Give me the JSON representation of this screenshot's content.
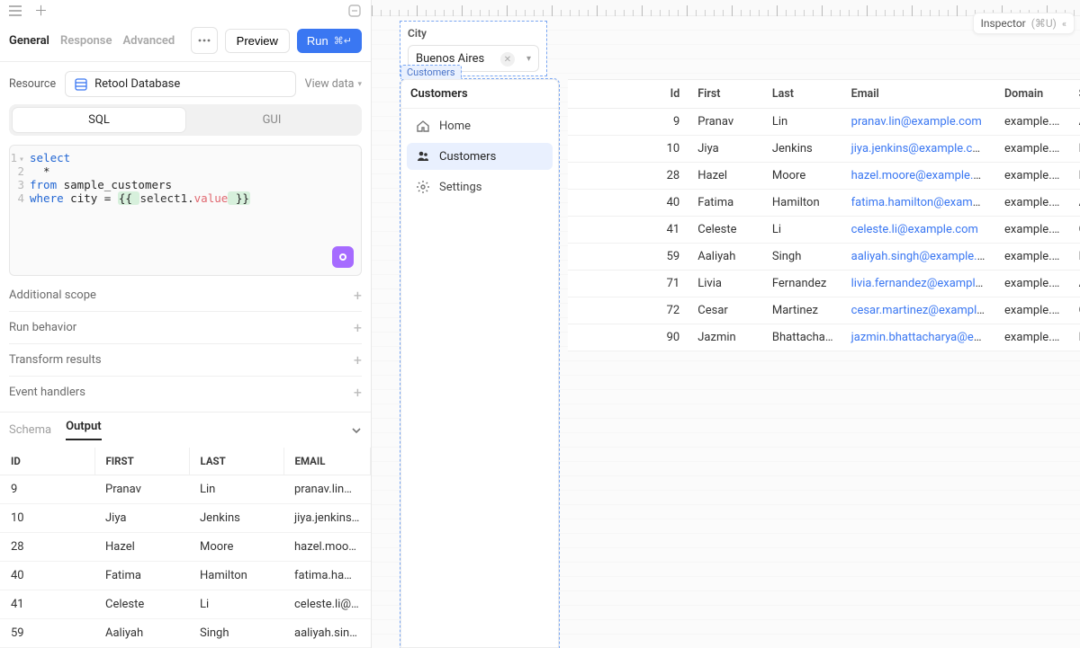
{
  "topbar": {
    "inspector_label": "Inspector",
    "inspector_shortcut": "(⌘U)"
  },
  "leftPanel": {
    "tabs": [
      "General",
      "Response",
      "Advanced"
    ],
    "activeTab": 0,
    "buttons": {
      "preview": "Preview",
      "run": "Run",
      "run_shortcut": "⌘↵"
    },
    "resource_label": "Resource",
    "resource_value": "Retool Database",
    "view_data": "View data",
    "segments": [
      "SQL",
      "GUI"
    ],
    "activeSegment": 0,
    "code": [
      {
        "kw": "select",
        "rest": ""
      },
      {
        "plain": "  *"
      },
      {
        "kw": "from",
        "rest": " sample_customers"
      },
      {
        "kw": "where",
        "rest_html": " city = ",
        "brace_open": "{{ ",
        "inner": "select1",
        "dot": ".",
        "prop": "value",
        "brace_close": " }}"
      }
    ],
    "options": [
      "Additional scope",
      "Run behavior",
      "Transform results",
      "Event handlers"
    ],
    "bottomTabs": [
      "Schema",
      "Output"
    ],
    "activeBottomTab": 1,
    "outputColumns": [
      "ID",
      "FIRST",
      "LAST",
      "EMAIL"
    ],
    "outputRows": [
      {
        "id": "9",
        "first": "Pranav",
        "last": "Lin",
        "email": "pranav.lin@example.com"
      },
      {
        "id": "10",
        "first": "Jiya",
        "last": "Jenkins",
        "email": "jiya.jenkins@example.com"
      },
      {
        "id": "28",
        "first": "Hazel",
        "last": "Moore",
        "email": "hazel.moore@example.com"
      },
      {
        "id": "40",
        "first": "Fatima",
        "last": "Hamilton",
        "email": "fatima.hamilton@example.com"
      },
      {
        "id": "41",
        "first": "Celeste",
        "last": "Li",
        "email": "celeste.li@example.com"
      },
      {
        "id": "59",
        "first": "Aaliyah",
        "last": "Singh",
        "email": "aaliyah.singh@example.com"
      }
    ]
  },
  "canvas": {
    "city": {
      "label": "City",
      "value": "Buenos Aires"
    },
    "sidebar": {
      "title": "Customers",
      "items": [
        {
          "icon": "home",
          "label": "Home",
          "active": false
        },
        {
          "icon": "people",
          "label": "Customers",
          "active": true
        },
        {
          "icon": "gear",
          "label": "Settings",
          "active": false
        }
      ]
    },
    "table": {
      "columns": [
        "Id",
        "First",
        "Last",
        "Email",
        "Domain",
        "St"
      ],
      "rows": [
        {
          "id": "9",
          "first": "Pranav",
          "last": "Lin",
          "email": "pranav.lin@example.com",
          "domain": "example.com",
          "st": "Av"
        },
        {
          "id": "10",
          "first": "Jiya",
          "last": "Jenkins",
          "email": "jiya.jenkins@example.com",
          "domain": "example.com",
          "st": "La"
        },
        {
          "id": "28",
          "first": "Hazel",
          "last": "Moore",
          "email": "hazel.moore@example.com",
          "domain": "example.com",
          "st": "La"
        },
        {
          "id": "40",
          "first": "Fatima",
          "last": "Hamilton",
          "email": "fatima.hamilton@example.com",
          "domain": "example.com",
          "st": "Av"
        },
        {
          "id": "41",
          "first": "Celeste",
          "last": "Li",
          "email": "celeste.li@example.com",
          "domain": "example.com",
          "st": "Ca"
        },
        {
          "id": "59",
          "first": "Aaliyah",
          "last": "Singh",
          "email": "aaliyah.singh@example.com",
          "domain": "example.com",
          "st": "La"
        },
        {
          "id": "71",
          "first": "Livia",
          "last": "Fernandez",
          "email": "livia.fernandez@example.com",
          "domain": "example.com",
          "st": "Av"
        },
        {
          "id": "72",
          "first": "Cesar",
          "last": "Martinez",
          "email": "cesar.martinez@example.com",
          "domain": "example.com",
          "st": "Ca"
        },
        {
          "id": "90",
          "first": "Jazmin",
          "last": "Bhattacharya",
          "email": "jazmin.bhattacharya@example.c…",
          "domain": "example.com",
          "st": "La"
        }
      ]
    }
  }
}
